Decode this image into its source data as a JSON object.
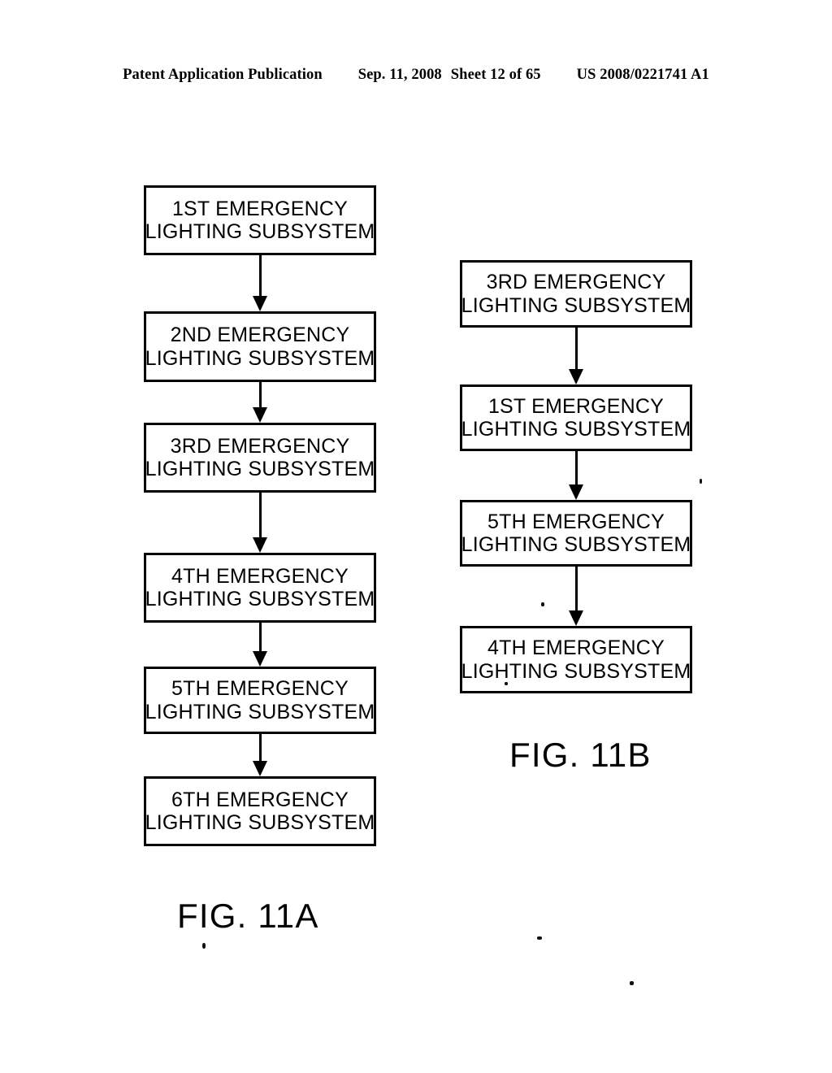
{
  "header": {
    "publication": "Patent Application Publication",
    "date": "Sep. 11, 2008",
    "sheet": "Sheet 12 of 65",
    "patent_number": "US 2008/0221741 A1"
  },
  "figures": [
    {
      "caption": "FIG. 11A",
      "boxes": [
        {
          "line1": "1ST EMERGENCY",
          "line2": "LIGHTING SUBSYSTEM"
        },
        {
          "line1": "2ND EMERGENCY",
          "line2": "LIGHTING SUBSYSTEM"
        },
        {
          "line1": "3RD EMERGENCY",
          "line2": "LIGHTING SUBSYSTEM"
        },
        {
          "line1": "4TH EMERGENCY",
          "line2": "LIGHTING SUBSYSTEM"
        },
        {
          "line1": "5TH EMERGENCY",
          "line2": "LIGHTING SUBSYSTEM"
        },
        {
          "line1": "6TH EMERGENCY",
          "line2": "LIGHTING SUBSYSTEM"
        }
      ]
    },
    {
      "caption": "FIG. 11B",
      "boxes": [
        {
          "line1": "3RD EMERGENCY",
          "line2": "LIGHTING SUBSYSTEM"
        },
        {
          "line1": "1ST EMERGENCY",
          "line2": "LIGHTING SUBSYSTEM"
        },
        {
          "line1": "5TH EMERGENCY",
          "line2": "LIGHTING SUBSYSTEM"
        },
        {
          "line1": "4TH EMERGENCY",
          "line2": "LIGHTING SUBSYSTEM"
        }
      ]
    }
  ],
  "colors": {
    "ink": "#000000",
    "paper": "#ffffff"
  }
}
